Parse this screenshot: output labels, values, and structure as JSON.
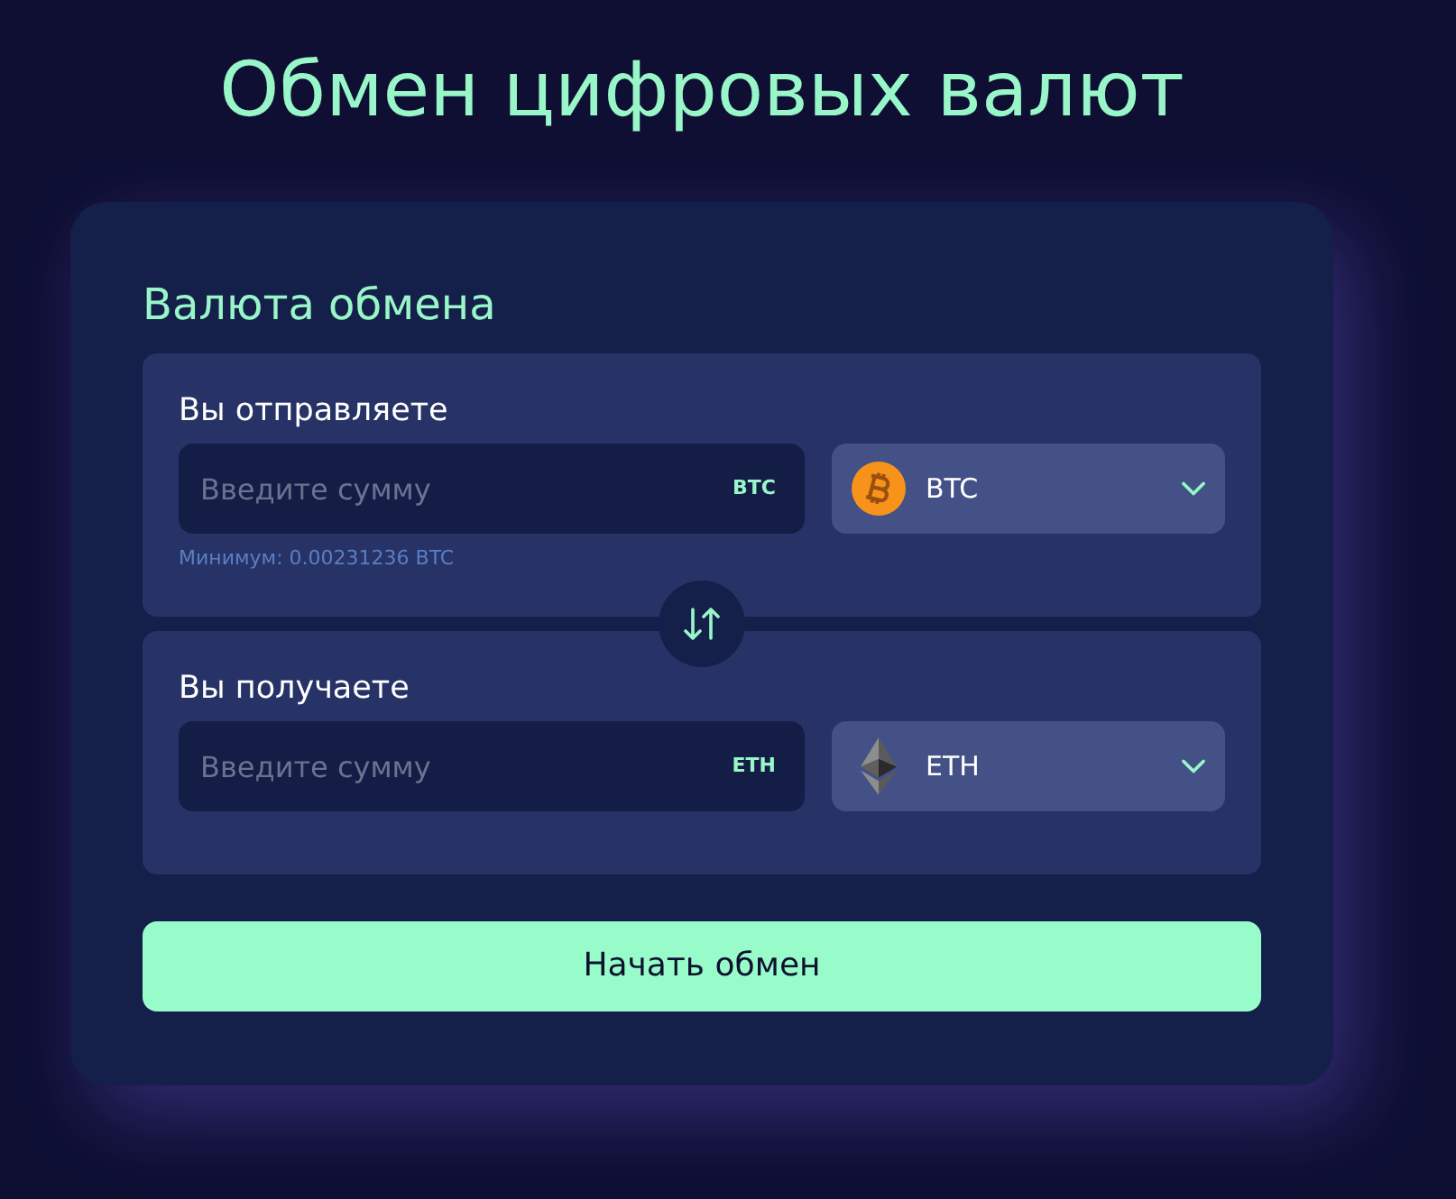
{
  "page": {
    "title": "Обмен цифровых валют"
  },
  "exchange_card": {
    "heading": "Валюта обмена",
    "panels": [
      {
        "label": "Вы отправляете",
        "amount_field": {
          "placeholder": "Введите сумму",
          "unit": "BTC"
        },
        "currency_select": {
          "kind": "bitcoin",
          "label": "BTC"
        },
        "minimum_note": "Минимум: 0.00231236 BTC"
      },
      {
        "label": "Вы получаете",
        "amount_field": {
          "placeholder": "Введите сумму",
          "unit": "ETH"
        },
        "currency_select": {
          "kind": "ethereum",
          "label": "ETH"
        }
      }
    ],
    "submit_button": "Начать обмен"
  }
}
